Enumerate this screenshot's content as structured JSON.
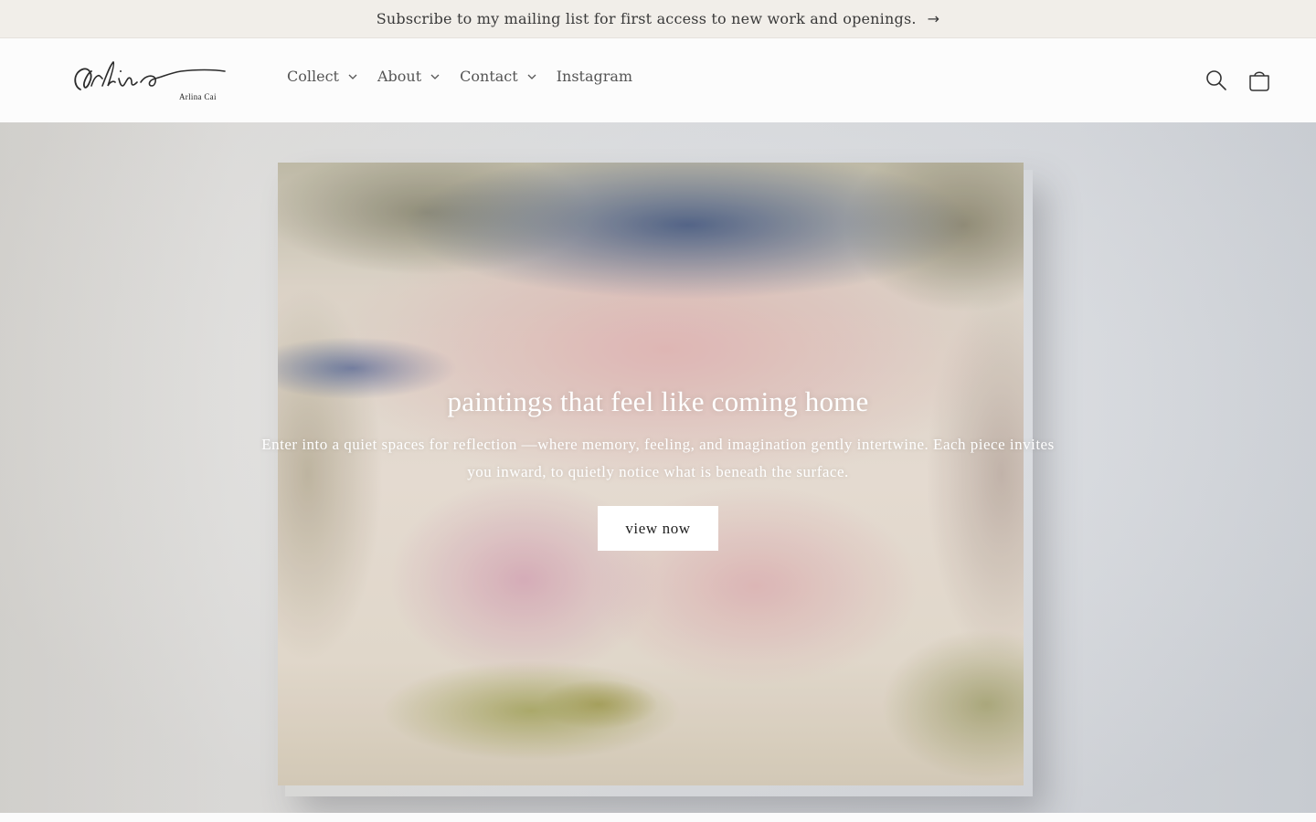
{
  "announcement": {
    "text": "Subscribe to my mailing list for first access to new work and openings.",
    "arrow_icon": "arrow-right-icon"
  },
  "header": {
    "logo": {
      "script_text": "Arlina",
      "sub_text": "Arlina Cai"
    },
    "nav": [
      {
        "label": "Collect",
        "has_dropdown": true
      },
      {
        "label": "About",
        "has_dropdown": true
      },
      {
        "label": "Contact",
        "has_dropdown": true
      },
      {
        "label": "Instagram",
        "has_dropdown": false
      }
    ],
    "icons": [
      "search-icon",
      "cart-icon"
    ]
  },
  "hero": {
    "title": "paintings that feel like coming home",
    "text": "Enter into a quiet spaces for reflection —where memory, feeling, and imagination gently intertwine. Each piece invites you inward, to quietly notice what is beneath the surface.",
    "button_label": "view now"
  },
  "colors": {
    "announcement_bg": "#f1eee9",
    "header_bg": "#fcfcfc",
    "text": "#555555",
    "button_bg": "#ffffff"
  }
}
